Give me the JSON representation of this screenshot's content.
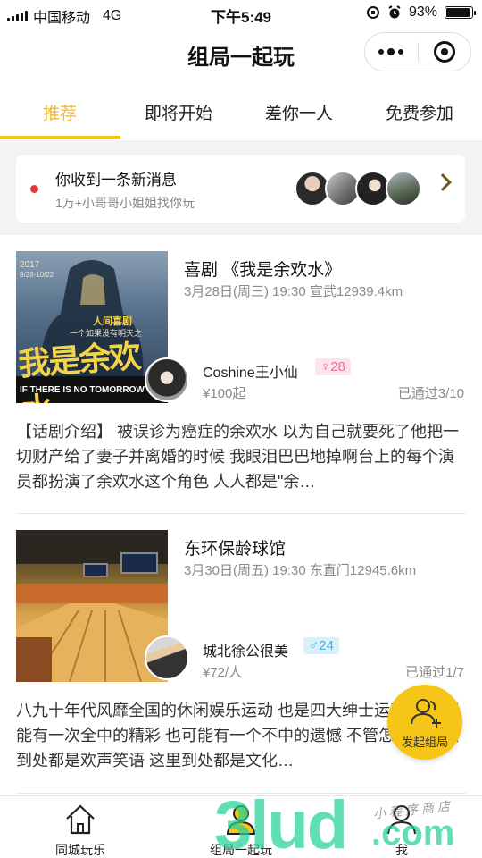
{
  "status_bar": {
    "carrier": "中国移动",
    "network": "4G",
    "time": "下午5:49",
    "battery": "93%",
    "battery_level": 0.93
  },
  "nav": {
    "title": "组局一起玩"
  },
  "tabs": [
    {
      "label": "推荐",
      "active": true
    },
    {
      "label": "即将开始",
      "active": false
    },
    {
      "label": "差你一人",
      "active": false
    },
    {
      "label": "免费参加",
      "active": false
    }
  ],
  "message": {
    "title": "你收到一条新消息",
    "subtitle": "1万+小哥哥小姐姐找你玩"
  },
  "events": [
    {
      "title": "喜剧 《我是余欢水》",
      "meta": "3月28日(周三) 19:30 宣武12939.4km",
      "host": "Coshine王小仙",
      "gender": "♀28",
      "price": "¥100起",
      "passed": "已通过3/10",
      "description": "【话剧介绍】 被误诊为癌症的余欢水 以为自己就要死了他把一切财产给了妻子并离婚的时候 我眼泪巴巴地掉啊台上的每个演员都扮演了余欢水这个角色 人人都是\"余…",
      "poster_text": {
        "year": "2017",
        "dates": "9/28-10/22",
        "tag": "人间喜剧",
        "sub": "一个如果没有明天之",
        "big": "我是余欢水",
        "en": "IF THERE IS NO TOMORROW"
      }
    },
    {
      "title": "东环保龄球馆",
      "meta": "3月30日(周五) 19:30 东直门12945.6km",
      "host": "城北徐公很美",
      "gender": "♂24",
      "price": "¥72/人",
      "passed": "已通过1/7",
      "description": "八九十年代风靡全国的休闲娱乐运动 也是四大绅士运动之一 可能有一次全中的精彩 也可能有一个不中的遗憾 不管怎样，这里到处都是欢声笑语 这里到处都是文化…"
    }
  ],
  "fab": {
    "label": "发起组局"
  },
  "bottom_tabs": [
    {
      "label": "同城玩乐"
    },
    {
      "label": "组局一起玩"
    },
    {
      "label": "我"
    }
  ],
  "watermark": {
    "text": "3lud",
    "suffix": ".com",
    "handwriting": "小程序商店"
  },
  "colors": {
    "accent": "#f5c518",
    "active_tab": "#f5b820",
    "female": "#ea6b97",
    "male": "#3fb2e1",
    "unread_dot": "#e23a3a"
  }
}
